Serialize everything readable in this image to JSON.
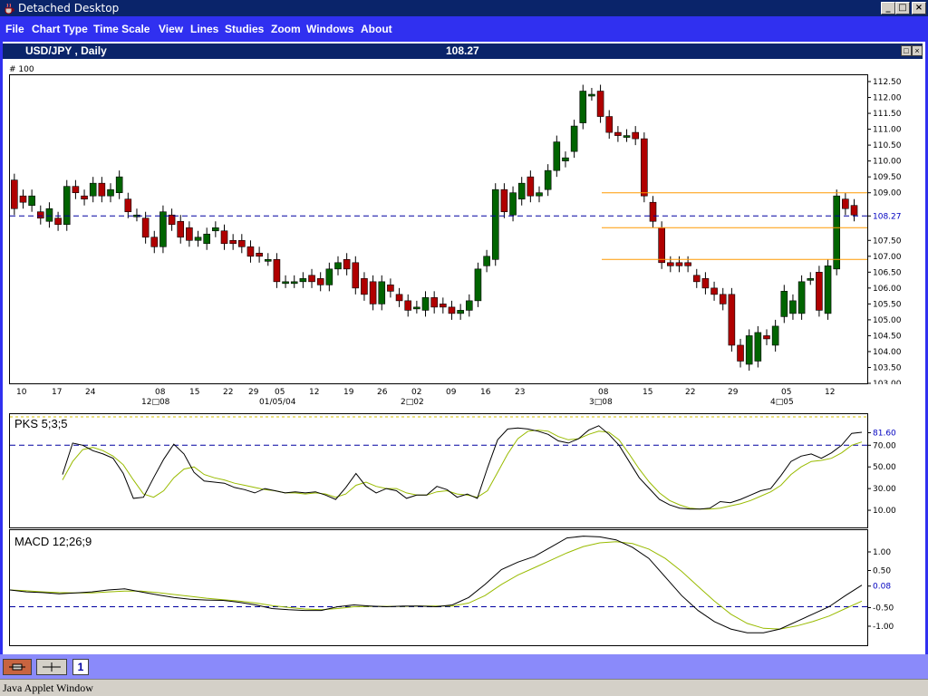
{
  "window": {
    "title": "Detached Desktop"
  },
  "menu": [
    "File",
    "Chart Type",
    "Time Scale",
    "View",
    "Lines",
    "Studies",
    "Zoom",
    "Windows",
    "About"
  ],
  "chart": {
    "symbol": "USD/JPY , Daily",
    "last_price": "108.27",
    "scale_label": "# 100"
  },
  "price_axis": {
    "ticks": [
      "112.50",
      "112.00",
      "111.50",
      "111.00",
      "110.50",
      "110.00",
      "109.50",
      "109.00",
      "108.27",
      "107.50",
      "107.00",
      "106.50",
      "106.00",
      "105.50",
      "105.00",
      "104.50",
      "104.00",
      "103.50",
      "103.00"
    ],
    "current_value": "108.27"
  },
  "time_axis": {
    "day_labels": [
      "10",
      "17",
      "24",
      "08",
      "15",
      "22",
      "29",
      "05",
      "12",
      "19",
      "26",
      "02",
      "09",
      "16",
      "23",
      "08",
      "15",
      "22",
      "29",
      "05",
      "12"
    ],
    "month_labels": [
      "12□08",
      "01/05/04",
      "2□02",
      "3□08",
      "4□05"
    ]
  },
  "pks": {
    "label": "PKS 5;3;5",
    "ticks": [
      "81.60",
      "70.00",
      "50.00",
      "30.00",
      "10.00"
    ],
    "current_value": "81.60"
  },
  "macd": {
    "label": "MACD 12;26;9",
    "ticks": [
      "1.00",
      "0.50",
      "0.08",
      "-0.50",
      "-1.00"
    ],
    "current_value": "0.08"
  },
  "taskbar": {
    "page_number": "1"
  },
  "status_text": "Java Applet Window",
  "colors": {
    "titlebar": "#0a246a",
    "menubar": "#3030f0",
    "up_candle": "#006400",
    "down_candle": "#b00000",
    "fib_line": "#ff9900",
    "ref_line": "#0000a0",
    "signal_line": "#99bb00",
    "bottom_bar": "#8a8afa"
  },
  "chart_data": {
    "type": "candlestick",
    "ylim": [
      103.0,
      112.7
    ],
    "candles": [
      [
        109.4,
        108.5
      ],
      [
        108.9,
        108.7
      ],
      [
        108.6,
        108.9
      ],
      [
        108.4,
        108.2
      ],
      [
        108.1,
        108.5
      ],
      [
        108.2,
        108.0
      ],
      [
        108.0,
        109.2
      ],
      [
        109.2,
        109.0
      ],
      [
        108.9,
        108.8
      ],
      [
        108.9,
        109.3
      ],
      [
        109.3,
        108.9
      ],
      [
        108.9,
        109.1
      ],
      [
        109.0,
        109.5
      ],
      [
        108.8,
        108.4
      ],
      [
        108.3,
        108.3
      ],
      [
        108.2,
        107.6
      ],
      [
        107.6,
        107.3
      ],
      [
        107.3,
        108.4
      ],
      [
        108.3,
        108.0
      ],
      [
        108.1,
        107.6
      ],
      [
        107.9,
        107.5
      ],
      [
        107.5,
        107.6
      ],
      [
        107.4,
        107.7
      ],
      [
        107.8,
        107.9
      ],
      [
        107.8,
        107.4
      ],
      [
        107.5,
        107.4
      ],
      [
        107.5,
        107.3
      ],
      [
        107.3,
        107.0
      ],
      [
        107.1,
        107.0
      ],
      [
        106.9,
        106.9
      ],
      [
        106.9,
        106.2
      ],
      [
        106.2,
        106.2
      ],
      [
        106.2,
        106.2
      ],
      [
        106.2,
        106.3
      ],
      [
        106.4,
        106.2
      ],
      [
        106.3,
        106.1
      ],
      [
        106.1,
        106.6
      ],
      [
        106.6,
        106.8
      ],
      [
        106.9,
        106.6
      ],
      [
        106.8,
        106.0
      ],
      [
        106.3,
        105.8
      ],
      [
        106.2,
        105.5
      ],
      [
        105.5,
        106.2
      ],
      [
        106.1,
        105.9
      ],
      [
        105.8,
        105.6
      ],
      [
        105.6,
        105.3
      ],
      [
        105.4,
        105.4
      ],
      [
        105.3,
        105.7
      ],
      [
        105.7,
        105.4
      ],
      [
        105.5,
        105.4
      ],
      [
        105.4,
        105.2
      ],
      [
        105.2,
        105.3
      ],
      [
        105.3,
        105.6
      ],
      [
        105.6,
        106.6
      ],
      [
        106.7,
        107.0
      ],
      [
        106.9,
        109.1
      ],
      [
        109.1,
        108.4
      ],
      [
        108.3,
        109.0
      ],
      [
        108.8,
        109.3
      ],
      [
        109.5,
        108.9
      ],
      [
        108.9,
        109.0
      ],
      [
        109.1,
        109.7
      ],
      [
        109.7,
        110.6
      ],
      [
        110.0,
        110.1
      ],
      [
        110.3,
        111.1
      ],
      [
        111.2,
        112.2
      ],
      [
        112.1,
        112.1
      ],
      [
        112.2,
        111.4
      ],
      [
        111.4,
        110.9
      ],
      [
        110.9,
        110.8
      ],
      [
        110.8,
        110.8
      ],
      [
        110.9,
        110.7
      ],
      [
        110.7,
        108.9
      ],
      [
        108.7,
        108.1
      ],
      [
        107.9,
        106.8
      ],
      [
        106.8,
        106.7
      ],
      [
        106.8,
        106.7
      ],
      [
        106.8,
        106.7
      ],
      [
        106.4,
        106.2
      ],
      [
        106.3,
        106.0
      ],
      [
        106.0,
        105.8
      ],
      [
        105.8,
        105.5
      ],
      [
        105.8,
        104.2
      ],
      [
        104.2,
        103.7
      ],
      [
        103.6,
        104.5
      ],
      [
        103.7,
        104.6
      ],
      [
        104.5,
        104.4
      ],
      [
        104.2,
        104.8
      ],
      [
        105.1,
        105.9
      ],
      [
        105.2,
        105.6
      ],
      [
        105.2,
        106.2
      ],
      [
        106.3,
        106.3
      ],
      [
        106.5,
        105.3
      ],
      [
        105.2,
        106.7
      ],
      [
        106.6,
        108.9
      ],
      [
        108.8,
        108.5
      ],
      [
        108.6,
        108.3
      ]
    ],
    "series": [
      {
        "name": "PKS 5;3;5",
        "values": [
          43,
          72,
          70,
          65,
          62,
          58,
          44,
          21,
          22,
          40,
          57,
          71,
          62,
          45,
          37,
          36,
          35,
          31,
          29,
          26,
          30,
          28,
          26,
          27,
          26,
          27,
          24,
          20,
          31,
          44,
          32,
          26,
          30,
          28,
          21,
          24,
          24,
          32,
          29,
          22,
          25,
          21,
          49,
          75,
          85,
          86,
          85,
          83,
          80,
          74,
          72,
          76,
          84,
          88,
          80,
          70,
          55,
          40,
          30,
          20,
          15,
          12,
          11,
          11,
          12,
          18,
          17,
          20,
          24,
          28,
          30,
          42,
          55,
          60,
          62,
          58,
          63,
          70,
          81,
          82
        ]
      },
      {
        "name": "signal",
        "values": [
          38,
          55,
          66,
          68,
          65,
          60,
          52,
          38,
          25,
          22,
          28,
          40,
          48,
          50,
          43,
          40,
          38,
          35,
          33,
          31,
          29,
          28,
          26,
          26,
          25,
          26,
          25,
          22,
          25,
          33,
          36,
          32,
          30,
          30,
          26,
          24,
          24,
          27,
          28,
          25,
          24,
          22,
          28,
          45,
          62,
          76,
          83,
          84,
          83,
          78,
          75,
          76,
          80,
          83,
          82,
          75,
          62,
          48,
          36,
          26,
          19,
          15,
          12,
          11,
          11,
          12,
          14,
          16,
          19,
          23,
          27,
          33,
          43,
          50,
          55,
          56,
          58,
          63,
          70,
          73
        ]
      },
      {
        "name": "MACD 12;26;9",
        "values": [
          -0.05,
          -0.1,
          -0.12,
          -0.15,
          -0.13,
          -0.1,
          -0.05,
          -0.02,
          -0.1,
          -0.18,
          -0.25,
          -0.3,
          -0.32,
          -0.33,
          -0.38,
          -0.45,
          -0.55,
          -0.58,
          -0.6,
          -0.6,
          -0.5,
          -0.45,
          -0.48,
          -0.5,
          -0.48,
          -0.48,
          -0.5,
          -0.45,
          -0.25,
          0.1,
          0.5,
          0.7,
          0.85,
          1.1,
          1.35,
          1.4,
          1.38,
          1.3,
          1.1,
          0.8,
          0.3,
          -0.2,
          -0.6,
          -0.9,
          -1.1,
          -1.2,
          -1.2,
          -1.1,
          -0.9,
          -0.7,
          -0.5,
          -0.2,
          0.08
        ]
      },
      {
        "name": "MACD signal",
        "values": [
          -0.05,
          -0.07,
          -0.1,
          -0.12,
          -0.13,
          -0.13,
          -0.1,
          -0.08,
          -0.08,
          -0.12,
          -0.17,
          -0.22,
          -0.27,
          -0.31,
          -0.35,
          -0.4,
          -0.47,
          -0.52,
          -0.56,
          -0.58,
          -0.55,
          -0.5,
          -0.49,
          -0.49,
          -0.49,
          -0.48,
          -0.48,
          -0.48,
          -0.4,
          -0.2,
          0.1,
          0.35,
          0.55,
          0.75,
          0.95,
          1.12,
          1.22,
          1.25,
          1.2,
          1.05,
          0.8,
          0.45,
          0.05,
          -0.35,
          -0.7,
          -0.95,
          -1.08,
          -1.1,
          -1.02,
          -0.9,
          -0.75,
          -0.55,
          -0.35
        ]
      }
    ],
    "reference_lines": {
      "price": 108.27,
      "pks": 70,
      "macd": -0.5
    },
    "fib_levels": [
      109.0,
      107.9,
      106.9
    ]
  }
}
